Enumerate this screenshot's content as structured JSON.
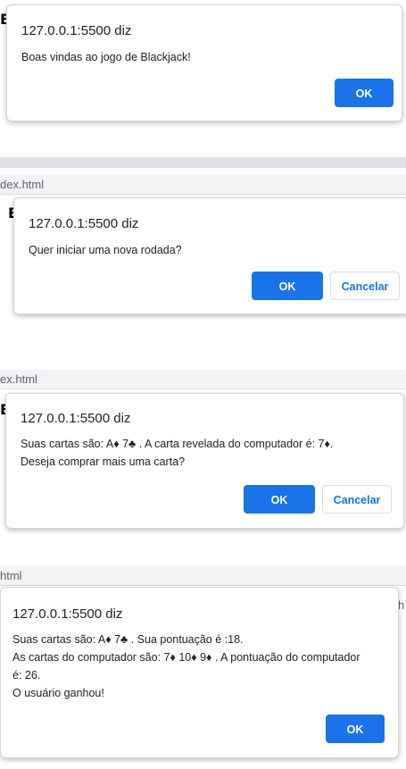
{
  "dialogs": [
    {
      "origin": "127.0.0.1:5500 diz",
      "message_lines": [
        "Boas vindas ao jogo de Blackjack!"
      ],
      "ok_label": "OK"
    },
    {
      "tab_fragment": "dex.html",
      "origin": "127.0.0.1:5500 diz",
      "message_lines": [
        "Quer iniciar uma nova rodada?"
      ],
      "ok_label": "OK",
      "cancel_label": "Cancelar"
    },
    {
      "tab_fragment": "ex.html",
      "origin": "127.0.0.1:5500 diz",
      "message_lines": [
        "Suas cartas são: A♦ 7♣ . A carta revelada do computador é: 7♦.",
        "Deseja comprar mais uma carta?"
      ],
      "ok_label": "OK",
      "cancel_label": "Cancelar"
    },
    {
      "tab_fragment": "html",
      "origin": "127.0.0.1:5500 diz",
      "message_lines": [
        "Suas cartas são: A♦ 7♣ . Sua pontuação é :18.",
        "As cartas do computador são: 7♦ 10♦ 9♦ . A pontuação do computador",
        "é: 26.",
        "O usuário ganhou!"
      ],
      "ok_label": "OK"
    }
  ],
  "page_fragments": {
    "heading_letter": "B",
    "right_edge_fragment": "h"
  },
  "colors": {
    "primary": "#1a73e8",
    "band": "#dee1e6",
    "toolbar": "#f1f3f4"
  }
}
